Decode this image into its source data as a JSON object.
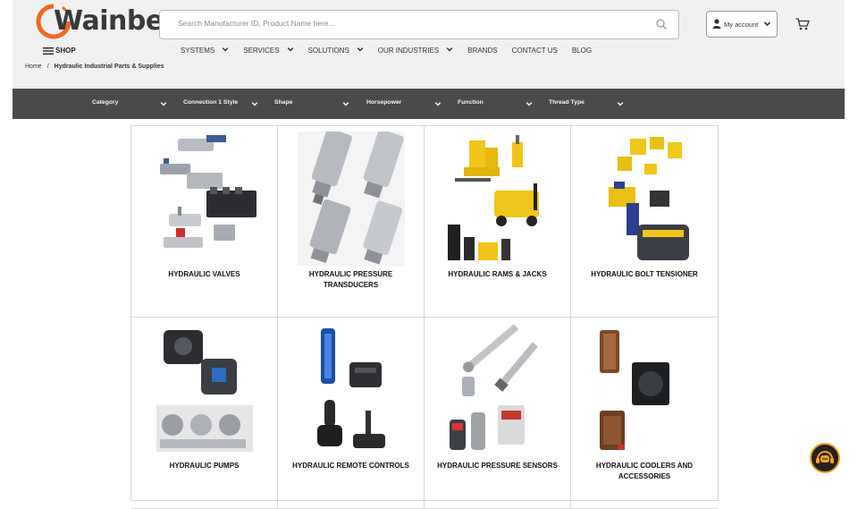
{
  "header": {
    "logo_text": "Wainbee",
    "search_placeholder": "Search Manufacturer ID, Product Name here...",
    "account_label": "My account",
    "shop_label": "SHOP"
  },
  "nav": {
    "items": [
      {
        "label": "SYSTEMS",
        "has_menu": true
      },
      {
        "label": "SERVICES",
        "has_menu": true
      },
      {
        "label": "SOLUTIONS",
        "has_menu": true
      },
      {
        "label": "OUR INDUSTRIES",
        "has_menu": true
      },
      {
        "label": "BRANDS",
        "has_menu": false
      },
      {
        "label": "CONTACT US",
        "has_menu": false
      },
      {
        "label": "BLOG",
        "has_menu": false
      }
    ]
  },
  "breadcrumb": {
    "home": "Home",
    "separator": "/",
    "current": "Hydraulic Industrial Parts & Supplies"
  },
  "filters": [
    {
      "label": "Category"
    },
    {
      "label": "Connection 1 Style"
    },
    {
      "label": "Shape"
    },
    {
      "label": "Horsepower"
    },
    {
      "label": "Function"
    },
    {
      "label": "Thread Type"
    }
  ],
  "categories": [
    {
      "title": "HYDRAULIC VALVES",
      "image": "hydraulic-valves"
    },
    {
      "title": "HYDRAULIC PRESSURE TRANSDUCERS",
      "image": "pressure-transducers"
    },
    {
      "title": "HYDRAULIC RAMS & JACKS",
      "image": "rams-jacks"
    },
    {
      "title": "HYDRAULIC BOLT TENSIONER",
      "image": "bolt-tensioner"
    },
    {
      "title": "HYDRAULIC PUMPS",
      "image": "hydraulic-pumps"
    },
    {
      "title": "HYDRAULIC REMOTE CONTROLS",
      "image": "remote-controls"
    },
    {
      "title": "HYDRAULIC PRESSURE SENSORS",
      "image": "pressure-sensors"
    },
    {
      "title": "HYDRAULIC COOLERS AND ACCESSORIES",
      "image": "coolers-accessories"
    }
  ],
  "colors": {
    "brand_orange": "#f26722",
    "filter_bar": "#4a4a4a",
    "header_bg": "#f1f1f1",
    "chat_ring": "#f6a21e"
  },
  "icons": [
    "search-icon",
    "user-icon",
    "chevron-down-icon",
    "cart-icon",
    "menu-icon",
    "chat-support-icon"
  ]
}
